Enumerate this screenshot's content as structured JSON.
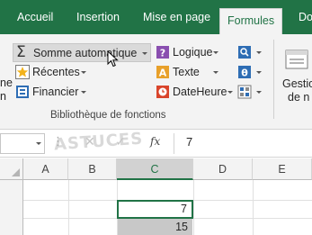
{
  "tabs": [
    {
      "label": "Accueil",
      "active": false
    },
    {
      "label": "Insertion",
      "active": false
    },
    {
      "label": "Mise en page",
      "active": false
    },
    {
      "label": "Formules",
      "active": true
    },
    {
      "label": "Do",
      "active": false
    }
  ],
  "ribbon": {
    "autosum_label": "Somme automatique",
    "recent_label": "Récentes",
    "financial_label": "Financier",
    "logical_label": "Logique",
    "text_label": "Texte",
    "datetime_label": "DateHeure",
    "group_label": "Bibliothèque de fonctions",
    "cut_left_1": "ne",
    "cut_left_2": "n",
    "cut_right_1": "Gestio",
    "cut_right_2": "de n"
  },
  "formula_bar": {
    "name_box": "",
    "value": "7",
    "fx": "fx"
  },
  "watermark": "ASTUCES",
  "columns": [
    "A",
    "B",
    "C",
    "D",
    "E"
  ],
  "selected_column": "C",
  "cells": {
    "c1": "7",
    "c2": "15"
  },
  "colors": {
    "excel_green": "#217346",
    "ribbon_bg": "#f3f3f3",
    "selection_gray": "#c8c8c8"
  }
}
